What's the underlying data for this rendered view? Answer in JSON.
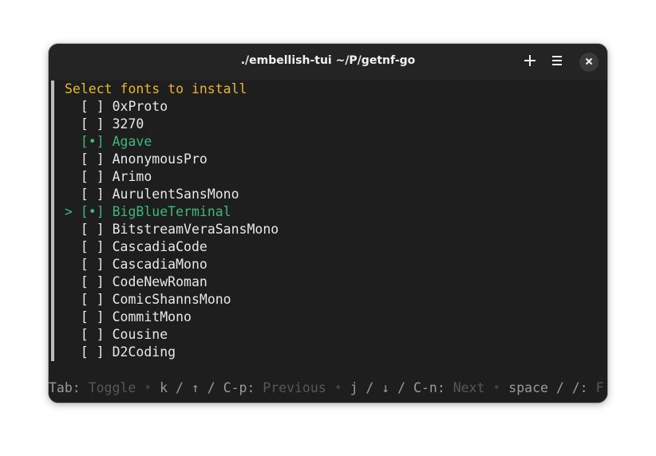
{
  "window": {
    "title": "./embellish-tui ~/P/getnf-go"
  },
  "prompt": "Select fonts to install",
  "cursor_glyph": ">",
  "fonts": [
    {
      "label": "0xProto",
      "checked": false,
      "cursor": false,
      "box": "[ ]"
    },
    {
      "label": "3270",
      "checked": false,
      "cursor": false,
      "box": "[ ]"
    },
    {
      "label": "Agave",
      "checked": true,
      "cursor": false,
      "box": "[•]"
    },
    {
      "label": "AnonymousPro",
      "checked": false,
      "cursor": false,
      "box": "[ ]"
    },
    {
      "label": "Arimo",
      "checked": false,
      "cursor": false,
      "box": "[ ]"
    },
    {
      "label": "AurulentSansMono",
      "checked": false,
      "cursor": false,
      "box": "[ ]"
    },
    {
      "label": "BigBlueTerminal",
      "checked": true,
      "cursor": true,
      "box": "[•]"
    },
    {
      "label": "BitstreamVeraSansMono",
      "checked": false,
      "cursor": false,
      "box": "[ ]"
    },
    {
      "label": "CascadiaCode",
      "checked": false,
      "cursor": false,
      "box": "[ ]"
    },
    {
      "label": "CascadiaMono",
      "checked": false,
      "cursor": false,
      "box": "[ ]"
    },
    {
      "label": "CodeNewRoman",
      "checked": false,
      "cursor": false,
      "box": "[ ]"
    },
    {
      "label": "ComicShannsMono",
      "checked": false,
      "cursor": false,
      "box": "[ ]"
    },
    {
      "label": "CommitMono",
      "checked": false,
      "cursor": false,
      "box": "[ ]"
    },
    {
      "label": "Cousine",
      "checked": false,
      "cursor": false,
      "box": "[ ]"
    },
    {
      "label": "D2Coding",
      "checked": false,
      "cursor": false,
      "box": "[ ]"
    }
  ],
  "help": [
    {
      "key": "Tab:",
      "desc": "Toggle"
    },
    {
      "key": "k / ↑ / C-p:",
      "desc": "Previous"
    },
    {
      "key": "j / ↓ / C-n:",
      "desc": "Next"
    },
    {
      "key": "space / /:",
      "desc": "F"
    }
  ],
  "help_separator": "•",
  "colors": {
    "prompt": "#e5b82f",
    "selected": "#3fb67c",
    "text": "#e8e8e8"
  },
  "icons": {
    "new_tab": "plus-icon",
    "menu": "hamburger-menu-icon",
    "close": "close-icon"
  }
}
